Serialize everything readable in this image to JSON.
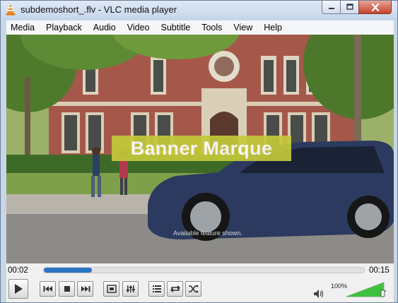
{
  "window": {
    "title": "subdemoshort_.flv - VLC media player"
  },
  "menu": {
    "items": [
      "Media",
      "Playback",
      "Audio",
      "Video",
      "Subtitle",
      "Tools",
      "View",
      "Help"
    ]
  },
  "video": {
    "marquee_text": "Banner Marque",
    "caption_text": "Available feature shown."
  },
  "playback": {
    "elapsed": "00:02",
    "total": "00:15",
    "progress_fraction": 0.15
  },
  "volume": {
    "label": "100%",
    "level_fraction": 1.0
  },
  "icons": {
    "app": "vlc-cone-icon",
    "play": "play-icon",
    "prev": "previous-icon",
    "stop": "stop-icon",
    "next": "next-icon",
    "fullscreen": "fullscreen-icon",
    "extended": "extended-settings-icon",
    "playlist": "playlist-icon",
    "loop": "loop-icon",
    "shuffle": "shuffle-icon",
    "speaker": "speaker-icon"
  },
  "colors": {
    "progress": "#2c74c5",
    "volume": "#3ec13e",
    "marquee_bg": "#c4c93a",
    "close_button": "#c4432d"
  }
}
